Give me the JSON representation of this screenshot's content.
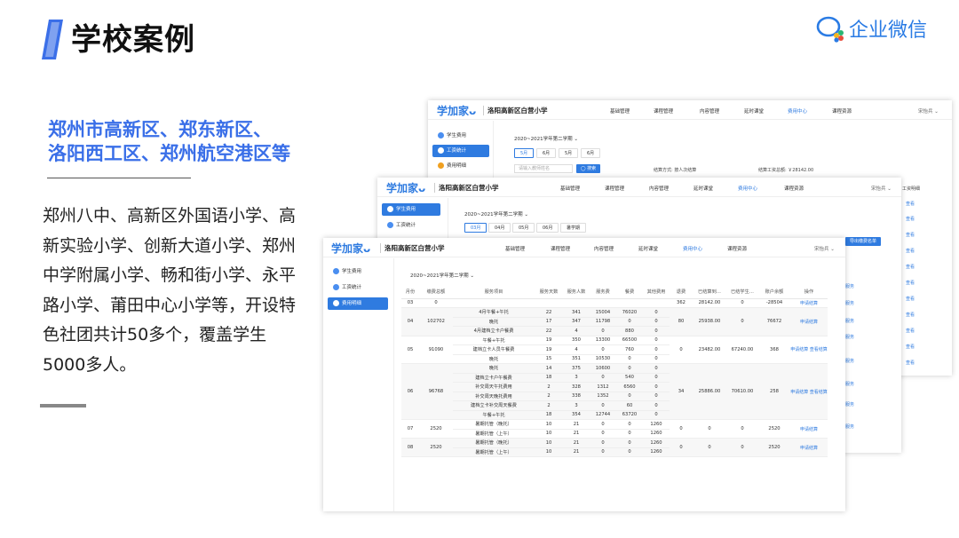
{
  "slide": {
    "title": "学校案例",
    "brand": "企业微信",
    "region_line1": "郑州市高新区、郑东新区、",
    "region_line2": "洛阳西工区、郑州航空港区等",
    "description": "郑州八中、高新区外国语小学、高新实验小学、创新大道小学、郑州中学附属小学、畅和街小学、永平路小学、莆田中心小学等，开设特色社团共计50多个，覆盖学生5000多人。"
  },
  "app": {
    "logo": "学加家",
    "school": "洛阳高新区白营小学",
    "user": "宋怡兵 ⌄",
    "term": "2020~2021学年第二学期 ⌄",
    "nav": [
      "基础管理",
      "课程管理",
      "内容管理",
      "延时课堂",
      "费用中心",
      "课程资源"
    ],
    "side": [
      "学生费用",
      "工资统计",
      "费用明细"
    ]
  },
  "card1": {
    "months": [
      "5月",
      "6月",
      "5月",
      "6月"
    ],
    "search_placeholder": "请输入教师姓名",
    "search_label": "◯ 搜索",
    "settle_label": "结算方式: 按人次结算",
    "wage_label": "结算工资总额: ￥28142.00",
    "right_header": "工资明细",
    "right_links": [
      "查看",
      "查看",
      "查看",
      "查看",
      "查看",
      "查看",
      "查看",
      "查看",
      "查看",
      "查看",
      "查看"
    ]
  },
  "card2": {
    "months": [
      "03月",
      "04月",
      "05月",
      "06月",
      "暑学期"
    ],
    "export_label": "导出缴费名单"
  },
  "table": {
    "headers": [
      "月份",
      "缴费总额",
      "服务项目",
      "服务天数",
      "服务人数",
      "服务费",
      "餐费",
      "其他费用",
      "退费",
      "已结算到…",
      "已结学生…",
      "账户余额",
      "操作"
    ],
    "groups": [
      {
        "month": "03",
        "total": "0",
        "refund": "362",
        "settled": "28142.00",
        "student": "0",
        "balance": "-28504",
        "op": "申请结算",
        "items": [
          [
            "",
            "",
            "",
            "",
            "",
            ""
          ]
        ]
      },
      {
        "month": "04",
        "total": "102702",
        "refund": "80",
        "settled": "25938.00",
        "student": "0",
        "balance": "76672",
        "op": "申请结算",
        "items": [
          [
            "4月午餐+午托",
            "22",
            "341",
            "15004",
            "76020",
            "0"
          ],
          [
            "晚托",
            "17",
            "347",
            "11798",
            "0",
            "0"
          ],
          [
            "4月建档立卡户餐费",
            "22",
            "4",
            "0",
            "880",
            "0"
          ]
        ]
      },
      {
        "month": "05",
        "total": "91090",
        "refund": "0",
        "settled": "23482.00",
        "student": "67240.00",
        "balance": "368",
        "op": "申请结算 查看结算",
        "items": [
          [
            "午餐+午托",
            "19",
            "350",
            "13300",
            "66500",
            "0"
          ],
          [
            "建档立卡人员午餐费",
            "19",
            "4",
            "0",
            "760",
            "0"
          ],
          [
            "晚托",
            "15",
            "351",
            "10530",
            "0",
            "0"
          ]
        ]
      },
      {
        "month": "06",
        "total": "96768",
        "refund": "34",
        "settled": "25886.00",
        "student": "70610.00",
        "balance": "258",
        "op": "申请结算 查看结算",
        "items": [
          [
            "晚托",
            "14",
            "375",
            "10600",
            "0",
            "0"
          ],
          [
            "建档立卡户午餐费",
            "18",
            "3",
            "0",
            "540",
            "0"
          ],
          [
            "补交周天午托费用",
            "2",
            "328",
            "1312",
            "6560",
            "0"
          ],
          [
            "补交周天晚托费用",
            "2",
            "338",
            "1352",
            "0",
            "0"
          ],
          [
            "建档立卡补交周天餐费",
            "2",
            "3",
            "0",
            "60",
            "0"
          ],
          [
            "午餐+午托",
            "18",
            "354",
            "12744",
            "63720",
            "0"
          ]
        ]
      },
      {
        "month": "07",
        "total": "2520",
        "refund": "0",
        "settled": "0",
        "student": "0",
        "balance": "2520",
        "op": "申请结算",
        "items": [
          [
            "暑期托管（晚托）",
            "10",
            "21",
            "0",
            "0",
            "1260"
          ],
          [
            "暑期托管（上午）",
            "10",
            "21",
            "0",
            "0",
            "1260"
          ]
        ]
      },
      {
        "month": "08",
        "total": "2520",
        "refund": "0",
        "settled": "0",
        "student": "0",
        "balance": "2520",
        "op": "申请结算",
        "items": [
          [
            "暑期托管（晚托）",
            "10",
            "21",
            "0",
            "0",
            "1260"
          ],
          [
            "暑期托管（上午）",
            "10",
            "21",
            "0",
            "0",
            "1260"
          ]
        ]
      }
    ]
  },
  "card2_right": [
    "服务",
    "服务",
    "服务",
    "服务",
    "服务",
    "服务",
    "服务",
    "服务"
  ],
  "colors": {
    "accent": "#2f7be0",
    "region_title": "#3a6fe8"
  }
}
